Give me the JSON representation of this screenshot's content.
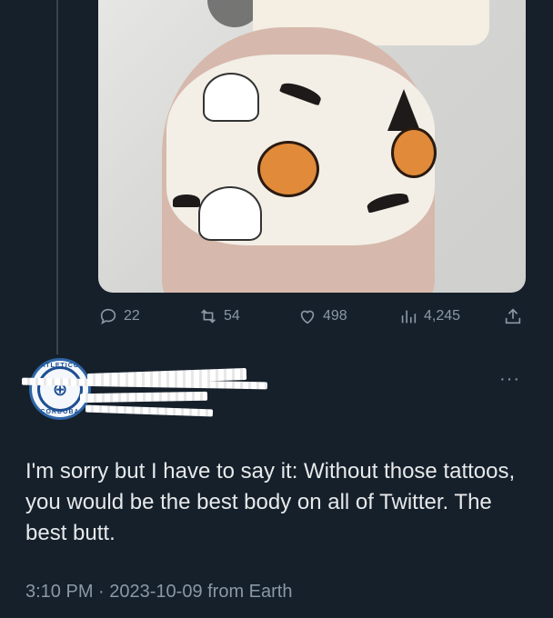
{
  "media": {
    "description_icon": "photo"
  },
  "actions": {
    "replies": "22",
    "retweets": "54",
    "likes": "498",
    "views": "4,245"
  },
  "avatar": {
    "top_text": "ATLETICO",
    "bottom_text": "CORDOBA"
  },
  "reply": {
    "more": "···",
    "text": "I'm sorry but I have to say it: Without those tattoos, you would be the best body on all of Twitter. The best butt.",
    "timestamp": "3:10 PM · 2023-10-09 from Earth"
  },
  "colors": {
    "background": "#15202b",
    "text": "#e7e9ea",
    "muted": "#8b98a5"
  }
}
